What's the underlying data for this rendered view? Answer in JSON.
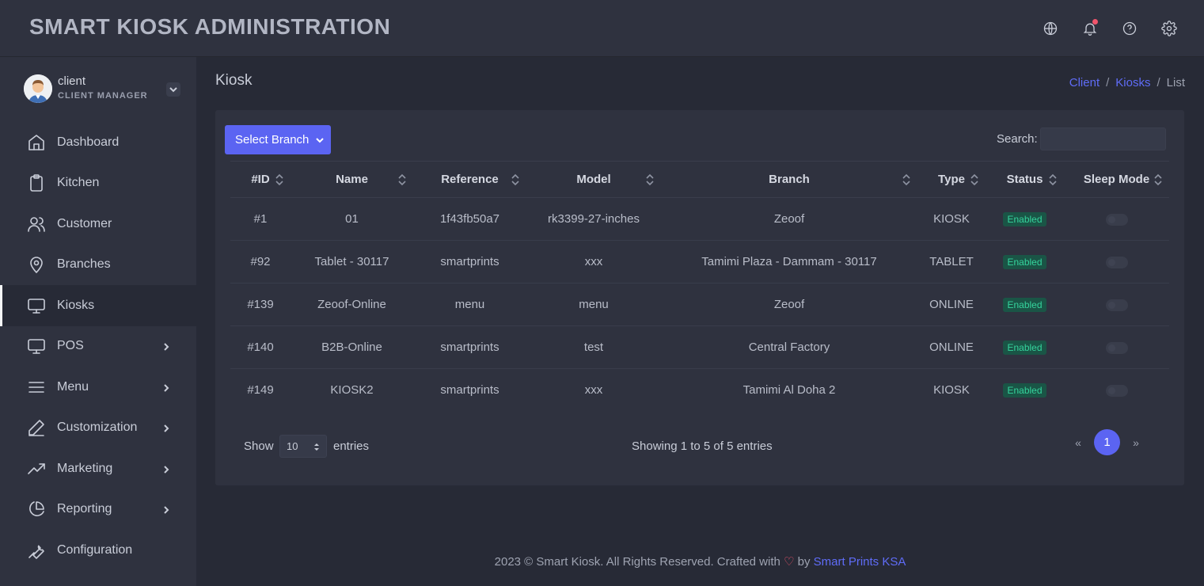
{
  "header": {
    "title": "SMART KIOSK ADMINISTRATION",
    "icons": [
      "globe-icon",
      "bell-icon",
      "help-icon",
      "gear-icon"
    ],
    "notification_dot_color": "#f1556c"
  },
  "user": {
    "name": "client",
    "role": "CLIENT MANAGER"
  },
  "sidebar": {
    "items": [
      {
        "label": "Dashboard",
        "icon": "home-icon",
        "expandable": false,
        "active": false
      },
      {
        "label": "Kitchen",
        "icon": "clipboard-icon",
        "expandable": false,
        "active": false
      },
      {
        "label": "Customer",
        "icon": "users-icon",
        "expandable": false,
        "active": false
      },
      {
        "label": "Branches",
        "icon": "map-pin-icon",
        "expandable": false,
        "active": false
      },
      {
        "label": "Kiosks",
        "icon": "monitor-icon",
        "expandable": false,
        "active": true
      },
      {
        "label": "POS",
        "icon": "monitor-icon",
        "expandable": true,
        "active": false
      },
      {
        "label": "Menu",
        "icon": "menu-icon",
        "expandable": true,
        "active": false
      },
      {
        "label": "Customization",
        "icon": "pen-icon",
        "expandable": true,
        "active": false
      },
      {
        "label": "Marketing",
        "icon": "trending-up-icon",
        "expandable": true,
        "active": false
      },
      {
        "label": "Reporting",
        "icon": "pie-chart-icon",
        "expandable": true,
        "active": false
      },
      {
        "label": "Configuration",
        "icon": "wrench-icon",
        "expandable": false,
        "active": false
      }
    ]
  },
  "page": {
    "title": "Kiosk",
    "breadcrumb": {
      "client": "Client",
      "kiosks": "Kiosks",
      "current": "List",
      "separator": "/"
    }
  },
  "toolbar": {
    "select_branch_label": "Select Branch",
    "search_label": "Search:",
    "search_value": ""
  },
  "table": {
    "columns": [
      "#ID",
      "Name",
      "Reference",
      "Model",
      "Branch",
      "Type",
      "Status",
      "Sleep Mode"
    ],
    "rows": [
      {
        "id": "#1",
        "name": "01",
        "reference": "1f43fb50a7",
        "model": "rk3399-27-inches",
        "branch": "Zeoof",
        "type": "KIOSK",
        "status": "Enabled",
        "sleep_mode": false
      },
      {
        "id": "#92",
        "name": "Tablet - 30117",
        "reference": "smartprints",
        "model": "xxx",
        "branch": "Tamimi Plaza - Dammam - 30117",
        "type": "TABLET",
        "status": "Enabled",
        "sleep_mode": false
      },
      {
        "id": "#139",
        "name": "Zeoof-Online",
        "reference": "menu",
        "model": "menu",
        "branch": "Zeoof",
        "type": "ONLINE",
        "status": "Enabled",
        "sleep_mode": false
      },
      {
        "id": "#140",
        "name": "B2B-Online",
        "reference": "smartprints",
        "model": "test",
        "branch": "Central Factory",
        "type": "ONLINE",
        "status": "Enabled",
        "sleep_mode": false
      },
      {
        "id": "#149",
        "name": "KIOSK2",
        "reference": "smartprints",
        "model": "xxx",
        "branch": "Tamimi Al Doha 2",
        "type": "KIOSK",
        "status": "Enabled",
        "sleep_mode": false
      }
    ]
  },
  "pagination": {
    "show_label": "Show",
    "page_length": "10",
    "entries_label": "entries",
    "info": "Showing 1 to 5 of 5 entries",
    "prev": "«",
    "current_page": "1",
    "next": "»"
  },
  "footer": {
    "text": "2023 © Smart Kiosk. All Rights Reserved. Crafted with",
    "by": "by",
    "link": "Smart Prints KSA"
  },
  "colors": {
    "accent": "#5b64f2",
    "link": "#5f6cf7",
    "badge_bg": "#1a5546",
    "badge_text": "#35d49d",
    "sidebar_bg": "#2f323f",
    "content_bg": "#272a36"
  }
}
